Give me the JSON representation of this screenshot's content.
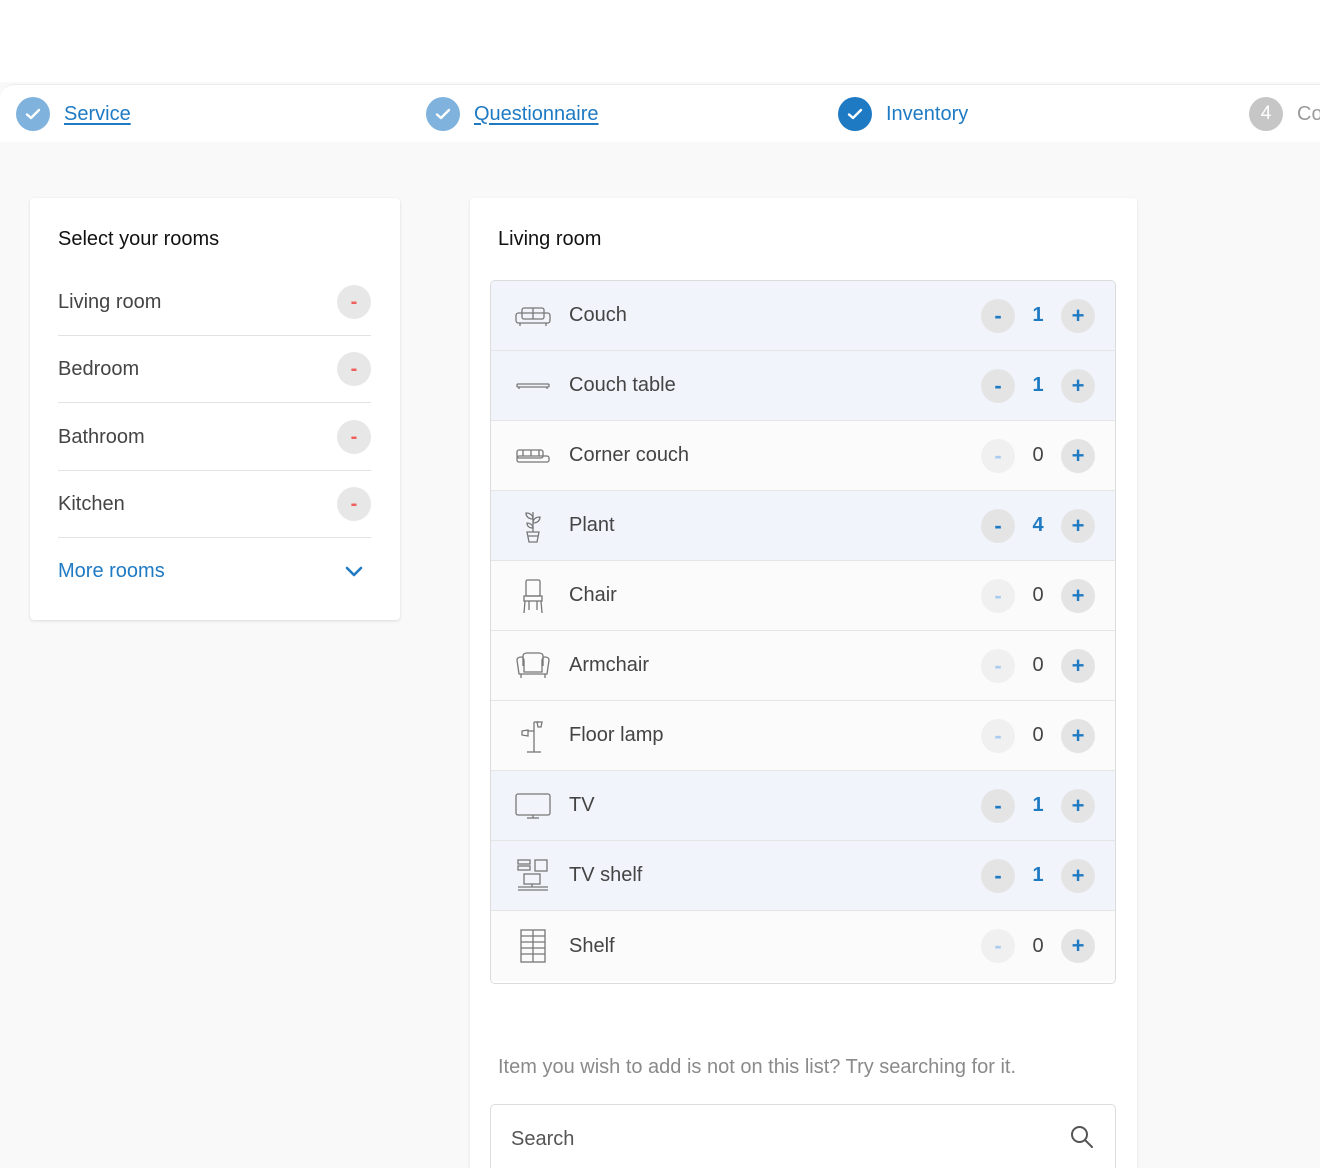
{
  "steps": [
    {
      "label": "Service",
      "state": "done",
      "number": ""
    },
    {
      "label": "Questionnaire",
      "state": "done",
      "number": ""
    },
    {
      "label": "Inventory",
      "state": "active",
      "number": ""
    },
    {
      "label": "Co",
      "state": "pending",
      "number": "4"
    }
  ],
  "rooms": {
    "title": "Select your rooms",
    "items": [
      {
        "label": "Living room",
        "remove": "-"
      },
      {
        "label": "Bedroom",
        "remove": "-"
      },
      {
        "label": "Bathroom",
        "remove": "-"
      },
      {
        "label": "Kitchen",
        "remove": "-"
      }
    ],
    "more_label": "More rooms"
  },
  "inventory": {
    "title": "Living room",
    "minus_symbol": "-",
    "plus_symbol": "+",
    "items": [
      {
        "label": "Couch",
        "icon": "couch-icon",
        "qty": "1"
      },
      {
        "label": "Couch table",
        "icon": "couch-table-icon",
        "qty": "1"
      },
      {
        "label": "Corner couch",
        "icon": "corner-couch-icon",
        "qty": "0"
      },
      {
        "label": "Plant",
        "icon": "plant-icon",
        "qty": "4"
      },
      {
        "label": "Chair",
        "icon": "chair-icon",
        "qty": "0"
      },
      {
        "label": "Armchair",
        "icon": "armchair-icon",
        "qty": "0"
      },
      {
        "label": "Floor lamp",
        "icon": "floor-lamp-icon",
        "qty": "0"
      },
      {
        "label": "TV",
        "icon": "tv-icon",
        "qty": "1"
      },
      {
        "label": "TV shelf",
        "icon": "tv-shelf-icon",
        "qty": "1"
      },
      {
        "label": "Shelf",
        "icon": "shelf-icon",
        "qty": "0"
      }
    ]
  },
  "search": {
    "hint": "Item you wish to add is not on this list? Try searching for it.",
    "placeholder": "Search"
  },
  "colors": {
    "accent": "#1f7ac4",
    "step_done": "#7fb3de",
    "remove": "#ef5f5f",
    "active_row": "#f1f5fb"
  }
}
